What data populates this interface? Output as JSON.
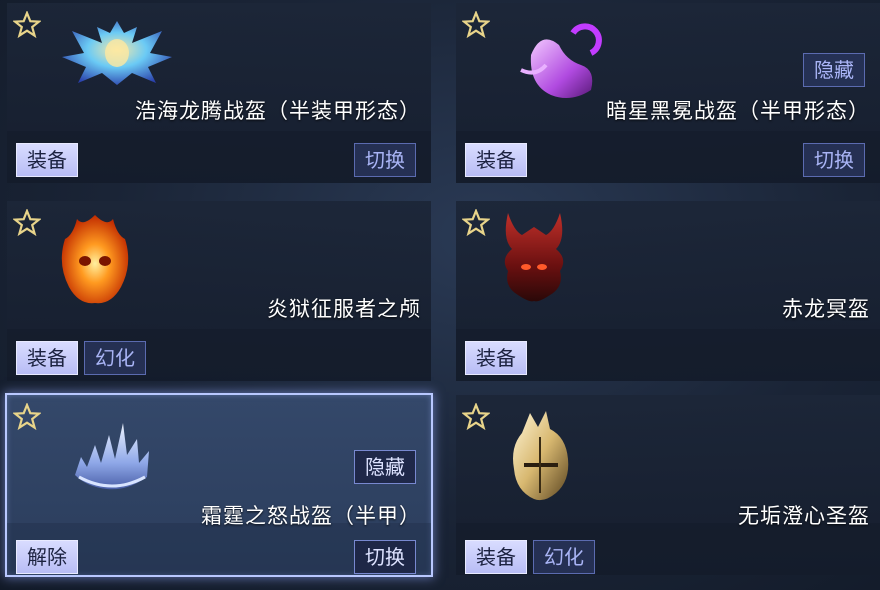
{
  "items": [
    {
      "name": "浩海龙腾战盔（半装甲形态）",
      "primary": "装备",
      "secondary": "切换",
      "tag": "",
      "icon": "blue-dragon-helmet-icon"
    },
    {
      "name": "暗星黑冕战盔（半甲形态）",
      "primary": "装备",
      "secondary": "切换",
      "tag": "隐藏",
      "icon": "purple-crescent-helmet-icon"
    },
    {
      "name": "炎狱征服者之颅",
      "primary": "装备",
      "secondary": "幻化",
      "tag": "",
      "icon": "flaming-skull-helmet-icon"
    },
    {
      "name": "赤龙冥盔",
      "primary": "装备",
      "secondary": "",
      "tag": "",
      "icon": "red-dragon-helmet-icon"
    },
    {
      "name": "霜霆之怒战盔（半甲）",
      "primary": "解除",
      "secondary": "切换",
      "tag": "隐藏",
      "icon": "frost-crown-icon"
    },
    {
      "name": "无垢澄心圣盔",
      "primary": "装备",
      "secondary": "幻化",
      "tag": "",
      "icon": "golden-holy-helmet-icon"
    }
  ],
  "colors": {
    "accent": "#b8bdf5",
    "selected_border": "#b9c8ff",
    "star": "#e8d48a"
  }
}
